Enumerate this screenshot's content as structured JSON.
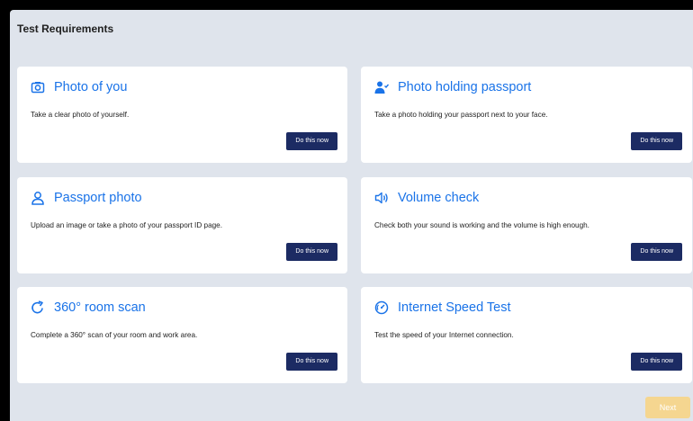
{
  "page": {
    "title": "Test Requirements"
  },
  "cards": [
    {
      "title": "Photo of you",
      "description": "Take a clear photo of yourself.",
      "button_label": "Do this now",
      "icon": "camera-icon"
    },
    {
      "title": "Photo holding passport",
      "description": "Take a photo holding your passport next to your face.",
      "button_label": "Do this now",
      "icon": "user-check-icon"
    },
    {
      "title": "Passport photo",
      "description": "Upload an image or take a photo of your passport ID page.",
      "button_label": "Do this now",
      "icon": "user-outline-icon"
    },
    {
      "title": "Volume check",
      "description": "Check both your sound is working and the volume is high enough.",
      "button_label": "Do this now",
      "icon": "speaker-icon"
    },
    {
      "title": "360° room scan",
      "description": "Complete a 360° scan of your room and work area.",
      "button_label": "Do this now",
      "icon": "rotate-icon"
    },
    {
      "title": "Internet Speed Test",
      "description": "Test the speed of your Internet connection.",
      "button_label": "Do this now",
      "icon": "speedometer-icon"
    }
  ],
  "footer": {
    "next_label": "Next"
  },
  "colors": {
    "accent": "#1a73e8",
    "button": "#1c2b63",
    "next_disabled": "#f5d690",
    "background": "#dfe4ec"
  }
}
